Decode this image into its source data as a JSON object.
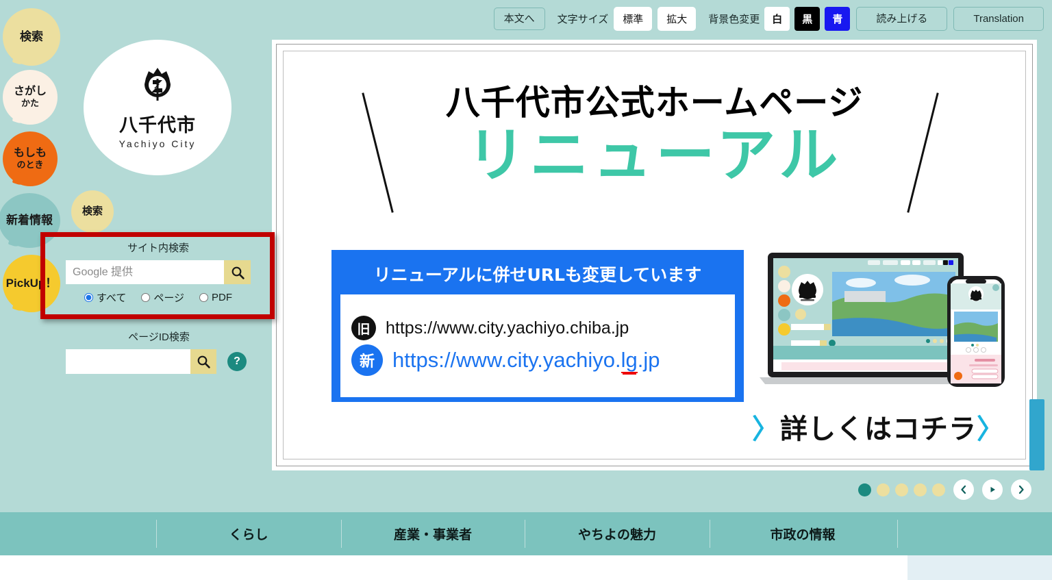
{
  "accessibility_bar": {
    "skip_to_content": "本文へ",
    "font_size_label": "文字サイズ",
    "font_size_options": [
      "標準",
      "拡大"
    ],
    "bg_color_label": "背景色変更",
    "bg_color_options": [
      "白",
      "黒",
      "青"
    ],
    "read_aloud": "読み上げる",
    "translation": "Translation"
  },
  "side_bubbles": [
    {
      "label": "検索",
      "sub": "",
      "color": "#ecdf9f"
    },
    {
      "label": "さがし",
      "sub": "かた",
      "color": "#fbf0e4"
    },
    {
      "label": "もしも",
      "sub": "のとき",
      "color": "#ef6b13"
    },
    {
      "label": "新着情報",
      "sub": "",
      "color": "#8cc6c3"
    },
    {
      "label": "PickUp！",
      "sub": "",
      "color": "#f5ca2e"
    },
    {
      "label": "検索",
      "sub": "",
      "color": "#ecdf9f"
    }
  ],
  "logo": {
    "name_jp": "八千代市",
    "name_en": "Yachiyo City"
  },
  "site_search": {
    "title": "サイト内検索",
    "placeholder": "Google 提供",
    "value": "",
    "search_icon": "magnifier-icon",
    "radios": [
      {
        "label": "すべて",
        "checked": true
      },
      {
        "label": "ページ",
        "checked": false
      },
      {
        "label": "PDF",
        "checked": false
      }
    ]
  },
  "pageid_search": {
    "title": "ページID検索",
    "placeholder": "",
    "value": "",
    "search_icon": "magnifier-icon",
    "help_label": "?"
  },
  "banner": {
    "headline_top": "八千代市公式ホームページ",
    "headline_main": "リニューアル",
    "url_card": {
      "title": "リニューアルに併せURLも変更しています",
      "old_badge": "旧",
      "old_url": "https://www.city.yachiyo.chiba.jp",
      "new_badge": "新",
      "new_url_prefix": "https://www.city.yachiyo.",
      "new_url_highlight": "lg",
      "new_url_suffix": ".jp",
      "card_color": "#1a73f0"
    },
    "cta": {
      "left_chevron": "〉",
      "text": "詳しくはコチラ",
      "right_chevron": "〉"
    },
    "accent_color": "#3ec7a7"
  },
  "carousel": {
    "dots": [
      {
        "active": true
      },
      {
        "active": false
      },
      {
        "active": false
      },
      {
        "active": false
      },
      {
        "active": false
      }
    ],
    "prev_icon": "chevron-left-icon",
    "play_icon": "play-icon",
    "next_icon": "chevron-right-icon",
    "active_color": "#1c8a80",
    "idle_color": "#ecdf9f"
  },
  "global_nav": {
    "items": [
      "くらし",
      "産業・事業者",
      "やちよの魅力",
      "市政の情報"
    ],
    "bar_color": "#7cc3be"
  },
  "theme": {
    "page_background": "#b4dad6",
    "scroll_thumb": "#31a6cd",
    "highlight_border": "#c10000"
  }
}
